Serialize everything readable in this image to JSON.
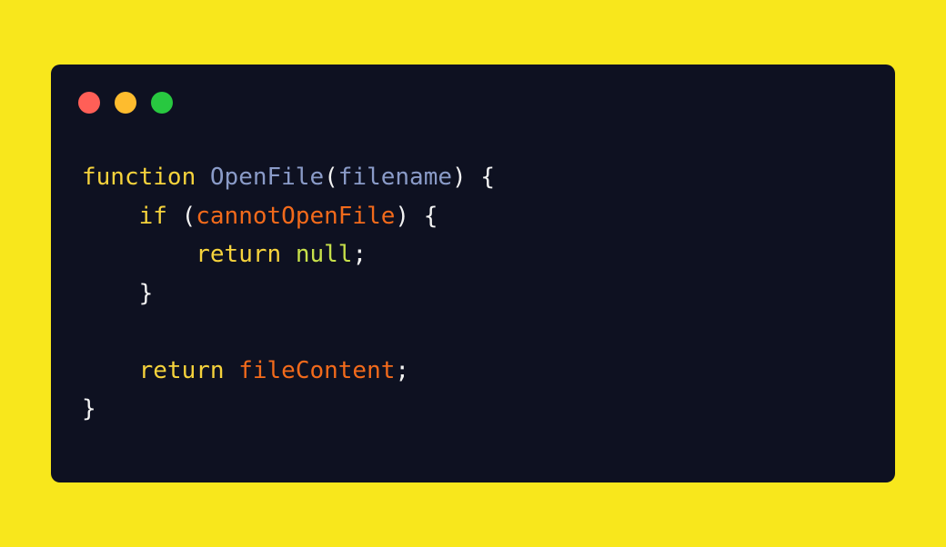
{
  "colors": {
    "background": "#F8E71C",
    "window": "#0E1121",
    "close": "#FF5F57",
    "minimize": "#FEBC2E",
    "maximize": "#28C840",
    "keyword": "#F6D33C",
    "function_name": "#8A9BC8",
    "parameter": "#8A9BC8",
    "punctuation": "#F2F2F2",
    "identifier": "#F26A1B",
    "literal": "#C7E04A"
  },
  "window_controls": [
    {
      "name": "close-button",
      "color_key": "close"
    },
    {
      "name": "minimize-button",
      "color_key": "minimize"
    },
    {
      "name": "maximize-button",
      "color_key": "maximize"
    }
  ],
  "code": {
    "lines": [
      {
        "indent": "",
        "tokens": [
          {
            "text": "function",
            "kind": "keyword"
          },
          {
            "text": " ",
            "kind": "punctuation"
          },
          {
            "text": "OpenFile",
            "kind": "function_name"
          },
          {
            "text": "(",
            "kind": "punctuation"
          },
          {
            "text": "filename",
            "kind": "parameter"
          },
          {
            "text": ") {",
            "kind": "punctuation"
          }
        ]
      },
      {
        "indent": "    ",
        "tokens": [
          {
            "text": "if",
            "kind": "keyword"
          },
          {
            "text": " (",
            "kind": "punctuation"
          },
          {
            "text": "cannotOpenFile",
            "kind": "identifier"
          },
          {
            "text": ") {",
            "kind": "punctuation"
          }
        ]
      },
      {
        "indent": "        ",
        "tokens": [
          {
            "text": "return",
            "kind": "keyword"
          },
          {
            "text": " ",
            "kind": "punctuation"
          },
          {
            "text": "null",
            "kind": "literal"
          },
          {
            "text": ";",
            "kind": "punctuation"
          }
        ]
      },
      {
        "indent": "    ",
        "tokens": [
          {
            "text": "}",
            "kind": "punctuation"
          }
        ]
      },
      {
        "indent": "",
        "tokens": []
      },
      {
        "indent": "    ",
        "tokens": [
          {
            "text": "return",
            "kind": "keyword"
          },
          {
            "text": " ",
            "kind": "punctuation"
          },
          {
            "text": "fileContent",
            "kind": "identifier"
          },
          {
            "text": ";",
            "kind": "punctuation"
          }
        ]
      },
      {
        "indent": "",
        "tokens": [
          {
            "text": "}",
            "kind": "punctuation"
          }
        ]
      }
    ]
  }
}
